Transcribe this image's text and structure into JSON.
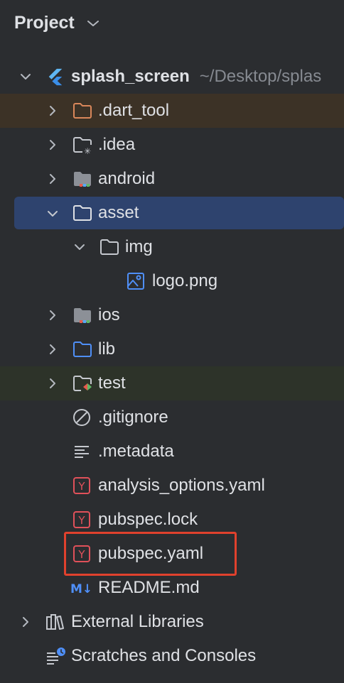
{
  "header": {
    "title": "Project"
  },
  "tree": {
    "root": {
      "label": "splash_screen",
      "path": "~/Desktop/splas"
    },
    "dart_tool": ".dart_tool",
    "idea": ".idea",
    "android": "android",
    "asset": "asset",
    "img": "img",
    "logo": "logo.png",
    "ios": "ios",
    "lib": "lib",
    "test": "test",
    "gitignore": ".gitignore",
    "metadata": ".metadata",
    "analysis_options": "analysis_options.yaml",
    "pubspec_lock": "pubspec.lock",
    "pubspec_yaml": "pubspec.yaml",
    "readme": "README.md",
    "external_libraries": "External Libraries",
    "scratches": "Scratches and Consoles"
  },
  "icons": {
    "yaml_badge": "Y",
    "markdown_badge": "M↓"
  },
  "colors": {
    "background": "#2b2d30",
    "selected_row": "#2e436e",
    "excluded_row": "#3c3226",
    "test_row": "#2d3329",
    "highlight_box": "#e0412d",
    "folder_blue": "#4f8ff7",
    "yaml_red": "#e0515a"
  }
}
